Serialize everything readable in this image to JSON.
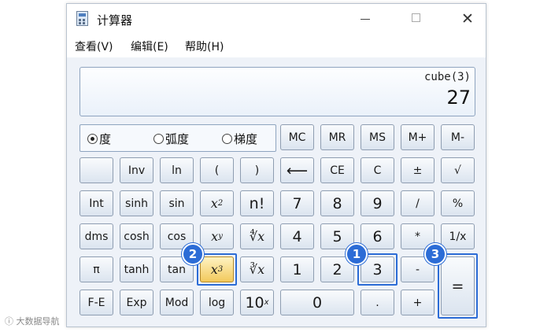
{
  "window": {
    "title": "计算器",
    "minimize": "",
    "maximize": "",
    "close": "✕"
  },
  "menu": [
    "查看(V)",
    "编辑(E)",
    "帮助(H)"
  ],
  "display": {
    "expression": "cube(3)",
    "value": "27"
  },
  "angle_mode": {
    "options": [
      "度",
      "弧度",
      "梯度"
    ],
    "selected": "度"
  },
  "buttons": {
    "mc": "MC",
    "mr": "MR",
    "ms": "MS",
    "mplus": "M+",
    "mminus": "M-",
    "inv": "Inv",
    "ln": "ln",
    "lparen": "(",
    "rparen": ")",
    "backspace": "⟵",
    "ce": "CE",
    "c": "C",
    "plusminus": "±",
    "sqrt": "√",
    "int": "Int",
    "sinh": "sinh",
    "sin": "sin",
    "x_sq_base": "x",
    "x_sq_exp": "2",
    "fact": "n!",
    "n7": "7",
    "n8": "8",
    "n9": "9",
    "div": "/",
    "percent": "%",
    "dms": "dms",
    "cosh": "cosh",
    "cos": "cos",
    "x_pow_base": "x",
    "x_pow_exp": "y",
    "yroot": "∜x",
    "n4": "4",
    "n5": "5",
    "n6": "6",
    "mul": "*",
    "recip": "1/x",
    "pi": "π",
    "tanh": "tanh",
    "tan": "tan",
    "x_cube_base": "x",
    "x_cube_exp": "3",
    "cuberoot": "∛x",
    "n1": "1",
    "n2": "2",
    "n3": "3",
    "sub": "-",
    "equals": "=",
    "fe": "F-E",
    "exp": "Exp",
    "mod": "Mod",
    "log": "log",
    "ten_base": "10",
    "ten_exp": "x",
    "n0": "0",
    "dot": ".",
    "add": "+"
  },
  "callouts": [
    "1",
    "2",
    "3"
  ],
  "corner_mark": "ⓘ 大数据导航"
}
